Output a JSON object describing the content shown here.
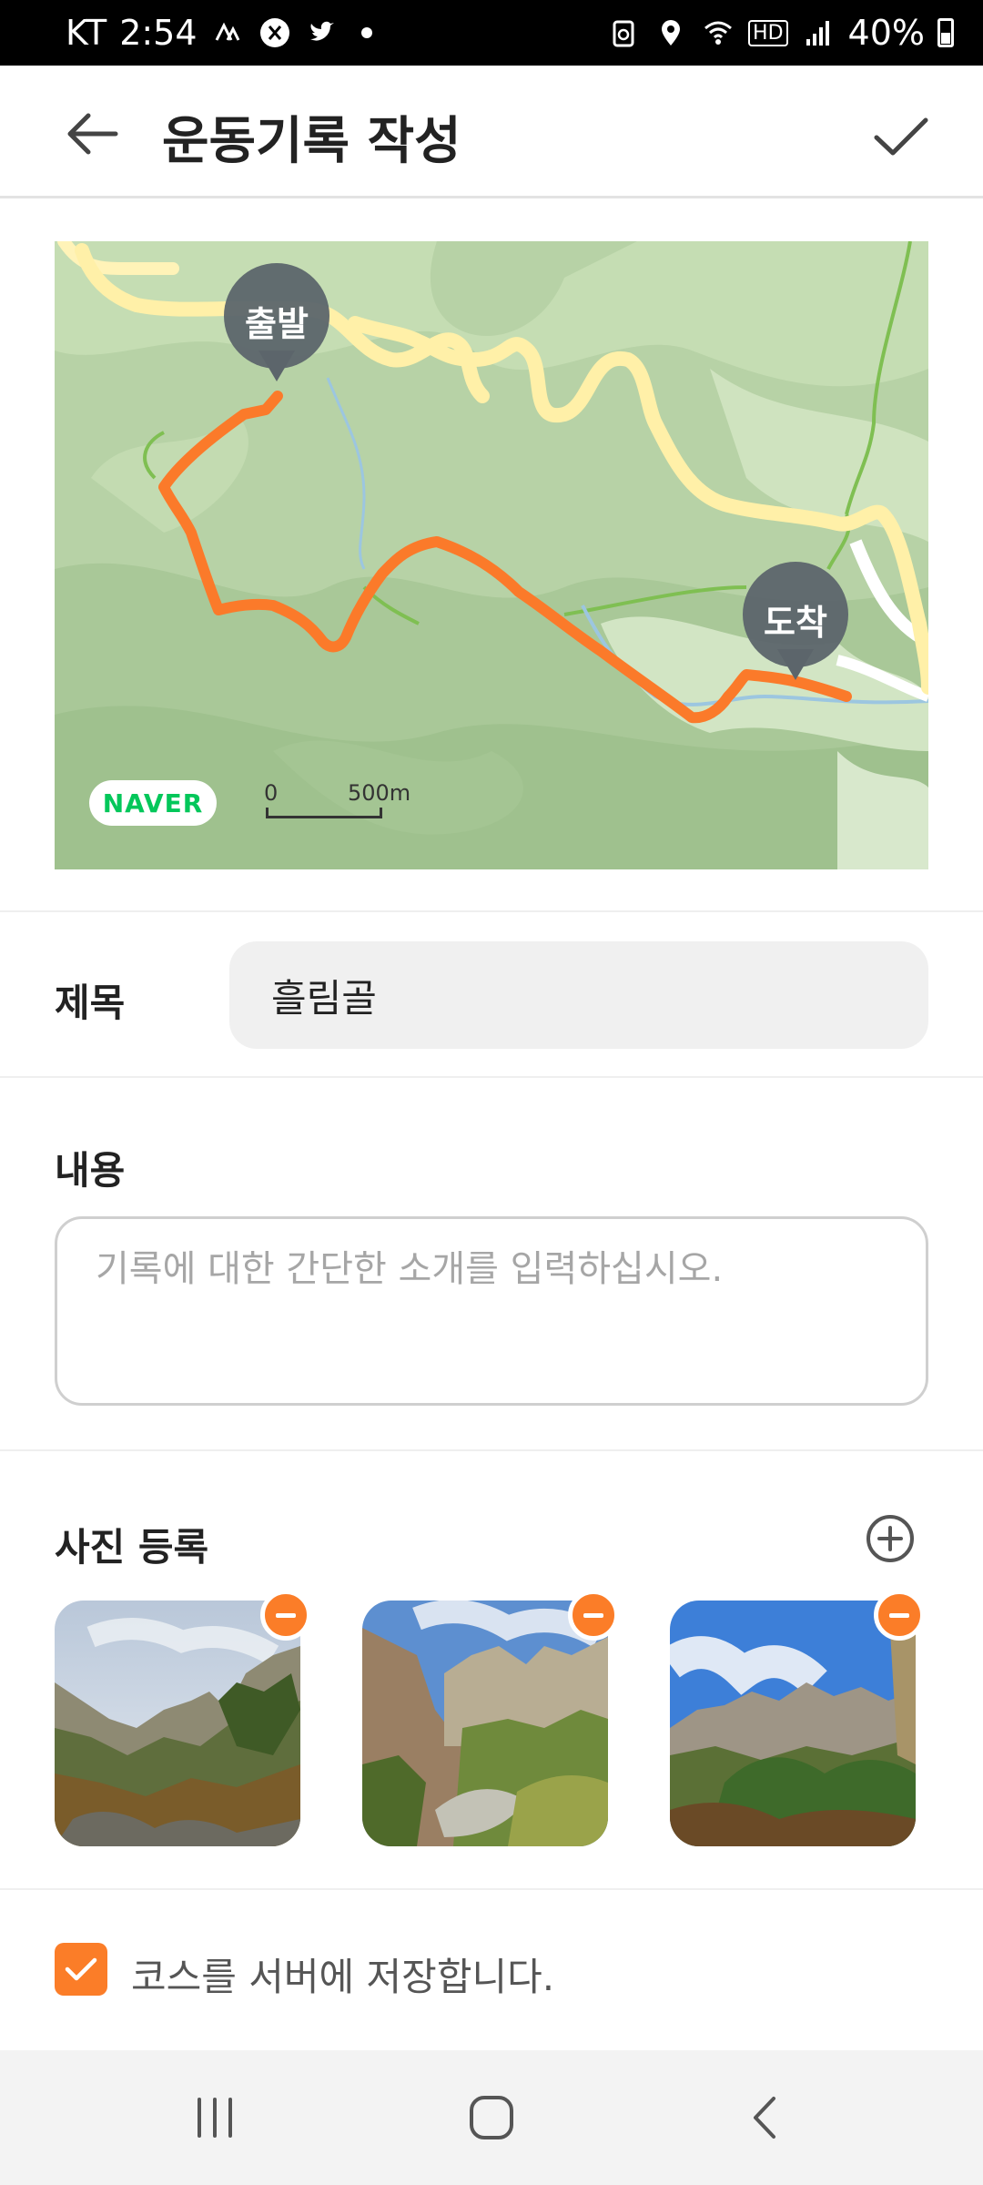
{
  "status_bar": {
    "carrier": "KT",
    "time": "2:54",
    "hd_label": "HD",
    "battery": "40%",
    "icons": [
      "strava-icon",
      "x-icon",
      "twitter-icon",
      "notification-dot-icon",
      "recycle-icon",
      "location-icon",
      "wifi-icon",
      "hd-icon",
      "signal-icon",
      "battery-icon"
    ]
  },
  "header": {
    "title": "운동기록 작성",
    "back_icon": "arrow-left-icon",
    "confirm_icon": "check-icon"
  },
  "map": {
    "start_label": "출발",
    "end_label": "도착",
    "provider": "NAVER",
    "scale_zero": "0",
    "scale_distance": "500m",
    "route_color": "#fb7a2a"
  },
  "form": {
    "title_label": "제목",
    "title_value": "흘림골",
    "content_label": "내용",
    "content_placeholder": "기록에 대한 간단한 소개를 입력하십시오.",
    "content_value": "",
    "photo_label": "사진 등록",
    "photo_count": 3,
    "save_course_checked": true,
    "save_course_label": "코스를 서버에 저장합니다."
  },
  "nav": {
    "icons": [
      "recent-apps-icon",
      "home-icon",
      "back-icon"
    ]
  },
  "colors": {
    "accent": "#fb7d28",
    "naver_green": "#03c75a",
    "marker_gray": "#5c656b"
  }
}
